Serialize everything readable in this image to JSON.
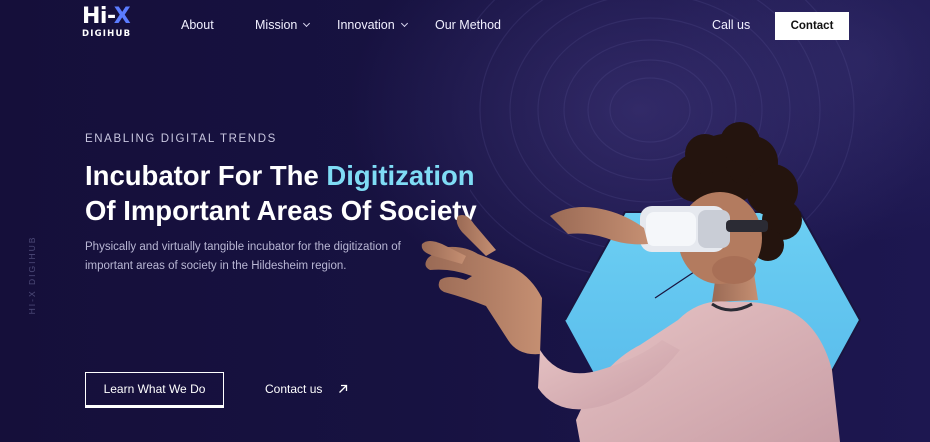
{
  "brand": {
    "logo_main": "Hi-",
    "logo_x": "X",
    "logo_sub": "DIGIHUB"
  },
  "nav": {
    "items": [
      {
        "label": "About",
        "has_dropdown": false
      },
      {
        "label": "Mission",
        "has_dropdown": true
      },
      {
        "label": "Innovation",
        "has_dropdown": true
      },
      {
        "label": "Our Method",
        "has_dropdown": false
      }
    ],
    "call_us": "Call us",
    "contact": "Contact"
  },
  "side_text": "HI-X DIGIHUB",
  "hero": {
    "eyebrow": "ENABLING DIGITAL TRENDS",
    "headline_part1": "Incubator For The ",
    "headline_accent": "Digitization",
    "headline_part2": "Of Important Areas Of Society",
    "description": "Physically and virtually tangible incubator for the digitization of important areas of society in the Hildesheim region.",
    "primary_cta": "Learn What We Do",
    "secondary_cta": "Contact us"
  },
  "icons": {
    "secondary_cta_icon": "arrow-up-right-icon",
    "dropdown_icon": "chevron-down-icon"
  },
  "colors": {
    "background": "#171241",
    "accent": "#7fdcf5",
    "hex_backdrop": "#62c3ee",
    "button_bg": "#ffffff"
  }
}
